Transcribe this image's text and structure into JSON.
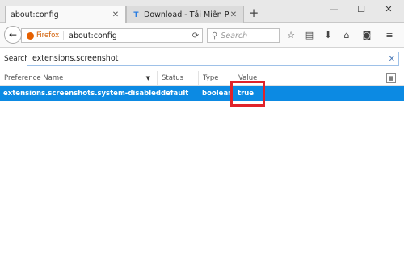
{
  "tabs": [
    {
      "title": "about:config",
      "active": true
    },
    {
      "title": "Download - Tải Miễn Phí VN",
      "active": false
    }
  ],
  "toolbar": {
    "brand": "Firefox",
    "url": "about:config",
    "search_placeholder": "Search"
  },
  "config": {
    "search_label": "Search:",
    "search_value": "extensions.screenshot",
    "columns": [
      "Preference Name",
      "Status",
      "Type",
      "Value"
    ],
    "rows": [
      {
        "name": "extensions.screenshots.system-disabled",
        "status": "default",
        "type": "boolean",
        "value": "true",
        "selected": true
      }
    ]
  },
  "colors": {
    "selection": "#0c8ae3",
    "highlight_box": "#e0232a",
    "firefox_orange": "#e66000"
  },
  "icons": [
    "close-icon",
    "new-tab-icon",
    "minimize-icon",
    "maximize-icon",
    "window-close-icon",
    "back-icon",
    "reload-icon",
    "search-icon",
    "bookmark-star-icon",
    "reading-list-icon",
    "download-icon",
    "home-icon",
    "pocket-icon",
    "menu-icon",
    "clear-icon",
    "column-picker-icon"
  ]
}
